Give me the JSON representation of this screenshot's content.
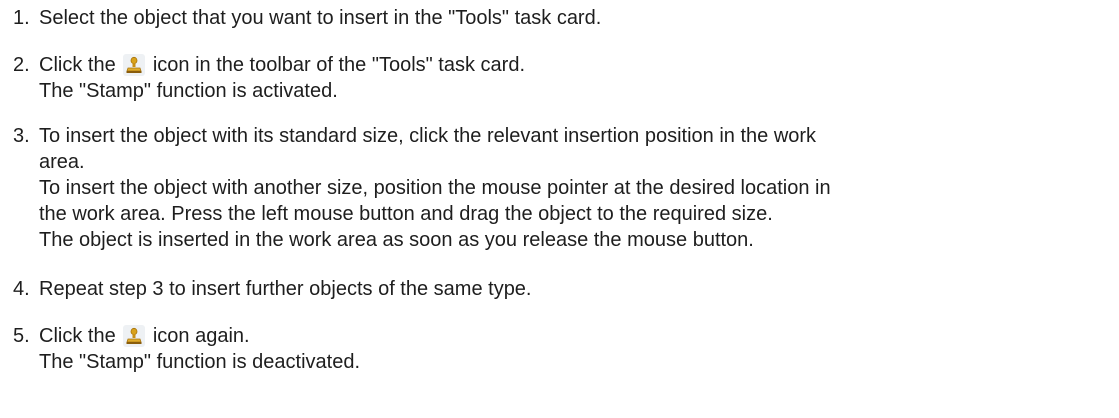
{
  "steps": [
    {
      "number": "1.",
      "lines": [
        "Select the object that you want to insert in the \"Tools\" task card."
      ]
    },
    {
      "number": "2.",
      "line1_before_icon": "Click the",
      "line1_after_icon": "icon in the toolbar of the \"Tools\" task card.",
      "icon": "stamp-icon",
      "result": "The \"Stamp\" function is activated."
    },
    {
      "number": "3.",
      "lines": [
        "To insert the object with its standard size, click the relevant insertion position in the work",
        "area.",
        "To insert the object with another size, position the mouse pointer at the desired location in",
        "the work area. Press the left mouse button and drag the object to the required size.",
        "The object is inserted in the work area as soon as you release the mouse button."
      ]
    },
    {
      "number": "4.",
      "lines": [
        "Repeat step 3 to insert further objects of the same type."
      ]
    },
    {
      "number": "5.",
      "line1_before_icon": "Click the",
      "line1_after_icon": "icon again.",
      "icon": "stamp-icon",
      "result": "The \"Stamp\" function is deactivated."
    }
  ],
  "colors": {
    "text": "#1e1e1e",
    "background": "#ffffff",
    "icon_bg": "#eef1f4",
    "icon_gold": "#d9a21b"
  }
}
